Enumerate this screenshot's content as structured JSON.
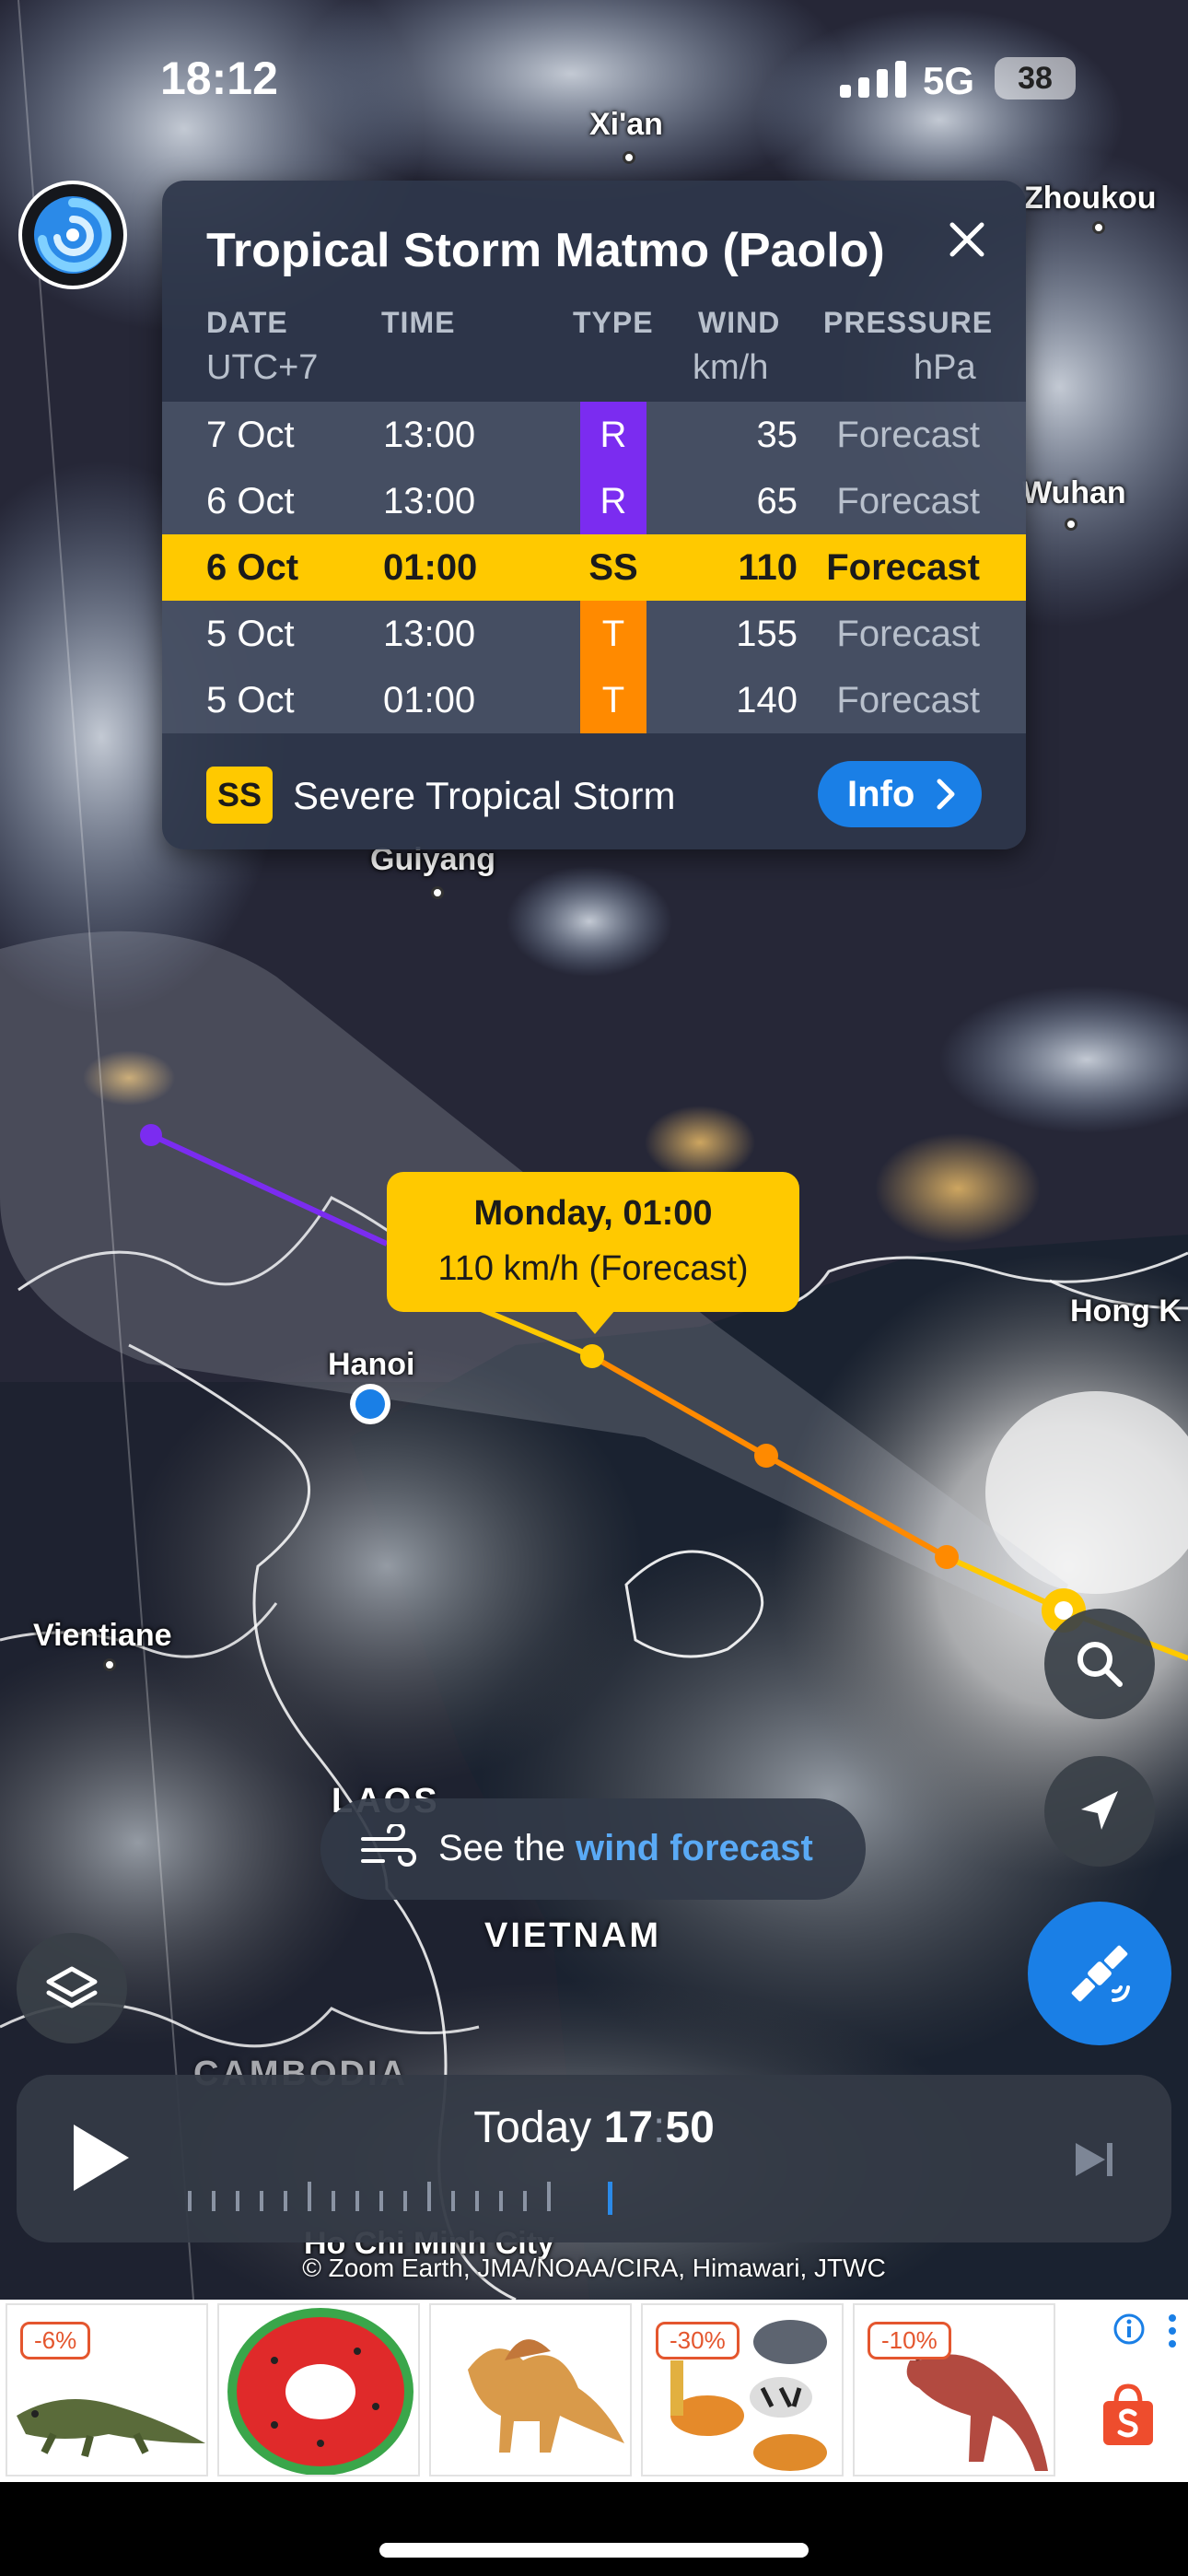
{
  "status_bar": {
    "time": "18:12",
    "network": "5G",
    "battery": "38"
  },
  "storm_panel": {
    "title": "Tropical Storm Matmo (Paolo)",
    "headers": {
      "date": "DATE",
      "date_sub": "UTC+7",
      "time": "TIME",
      "type": "TYPE",
      "wind": "WIND",
      "wind_sub": "km/h",
      "pressure": "PRESSURE",
      "pressure_sub": "hPa"
    },
    "rows": [
      {
        "date": "7 Oct",
        "time": "13:00",
        "type": "R",
        "type_color": "#7b2cf0",
        "wind": "35",
        "pressure": "Forecast"
      },
      {
        "date": "6 Oct",
        "time": "13:00",
        "type": "R",
        "type_color": "#7b2cf0",
        "wind": "65",
        "pressure": "Forecast"
      },
      {
        "date": "6 Oct",
        "time": "01:00",
        "type": "SS",
        "type_color": "#ffc900",
        "wind": "110",
        "pressure": "Forecast",
        "highlighted": true
      },
      {
        "date": "5 Oct",
        "time": "13:00",
        "type": "T",
        "type_color": "#ff8a00",
        "wind": "155",
        "pressure": "Forecast"
      },
      {
        "date": "5 Oct",
        "time": "01:00",
        "type": "T",
        "type_color": "#ff8a00",
        "wind": "140",
        "pressure": "Forecast"
      }
    ],
    "legend": {
      "badge": "SS",
      "label": "Severe Tropical Storm",
      "info_button": "Info"
    }
  },
  "map": {
    "cities": {
      "xian": "Xi'an",
      "zhoukou": "Zhoukou",
      "wuhan": "Wuhan",
      "guiyang": "Guiyang",
      "hanoi": "Hanoi",
      "hong_kong": "Hong K",
      "vientiane": "Vientiane",
      "hcmc": "Ho Chi Minh City"
    },
    "countries": {
      "vietnam": "VIETNAM",
      "laos": "LAOS",
      "cambodia": "CAMBODIA"
    },
    "callout": {
      "date": "Monday, 01:00",
      "wind": "110 km/h (Forecast)"
    },
    "colors": {
      "remnant": "#7b2cf0",
      "severe": "#ffc900",
      "typhoon": "#ff8a00",
      "location": "#1a7fe6"
    }
  },
  "wind_pill": {
    "prefix": "See the",
    "link": "wind forecast"
  },
  "timeline": {
    "day": "Today",
    "hour": "17",
    "sep": ":",
    "minute": "50"
  },
  "credit": "© Zoom Earth, JMA/NOAA/CIRA, Himawari, JTWC",
  "ads": [
    {
      "discount": "-6%",
      "subject": "crocodile-toy"
    },
    {
      "discount": "",
      "subject": "watermelon-swim-ring"
    },
    {
      "discount": "",
      "subject": "dinosaur-toy"
    },
    {
      "discount": "-30%",
      "subject": "animal-figures"
    },
    {
      "discount": "-10%",
      "subject": "dinosaur-figure"
    }
  ],
  "icons": [
    "close-icon",
    "chevron-right-icon",
    "wind-icon",
    "search-icon",
    "navigate-icon",
    "satellite-icon",
    "layers-icon",
    "play-icon",
    "skip-end-icon",
    "adchoices-icon",
    "shopee-bag-icon"
  ]
}
